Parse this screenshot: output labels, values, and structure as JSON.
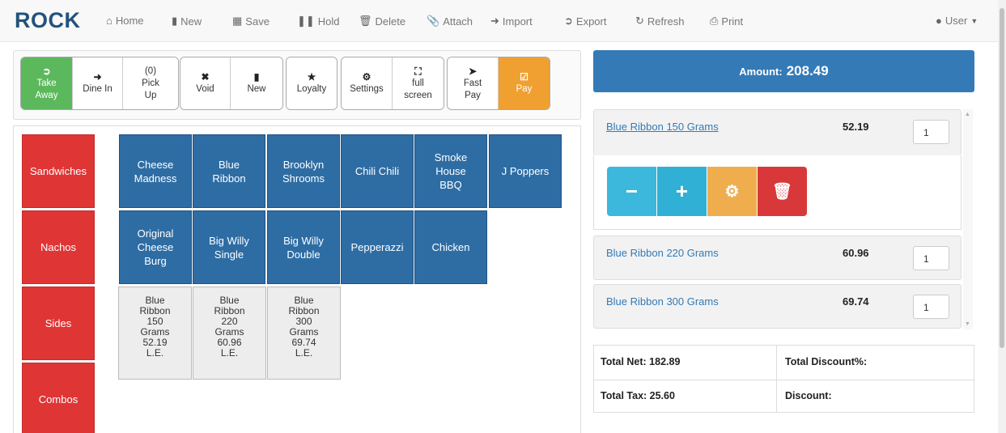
{
  "brand": "ROCK",
  "nav": {
    "home": "Home",
    "new": "New",
    "save": "Save",
    "hold": "Hold",
    "delete": "Delete",
    "attach": "Attach",
    "import": "Import",
    "export": "Export",
    "refresh": "Refresh",
    "print": "Print",
    "user": "User"
  },
  "actions": {
    "take_away_1": "Take",
    "take_away_2": "Away",
    "dine_in": "Dine In",
    "pickup_count": "(0)",
    "pickup_1": "Pick",
    "pickup_2": "Up",
    "void": "Void",
    "new": "New",
    "loyalty": "Loyalty",
    "settings": "Settings",
    "fullscreen_1": "full",
    "fullscreen_2": "screen",
    "fastpay_1": "Fast",
    "fastpay_2": "Pay",
    "pay": "Pay"
  },
  "categories": [
    "Sandwiches",
    "Nachos",
    "Sides",
    "Combos"
  ],
  "products": {
    "row1": [
      [
        "Cheese",
        "Madness"
      ],
      [
        "Blue",
        "Ribbon"
      ],
      [
        "Brooklyn",
        "Shrooms"
      ],
      [
        "Chili Chili"
      ],
      [
        "Smoke",
        "House",
        "BBQ"
      ],
      [
        "J Poppers"
      ]
    ],
    "row2": [
      [
        "Original",
        "Cheese",
        "Burg"
      ],
      [
        "Big Willy",
        "Single"
      ],
      [
        "Big Willy",
        "Double"
      ],
      [
        "Pepperazzi"
      ],
      [
        "Chicken"
      ]
    ]
  },
  "variants": [
    {
      "l1": "Blue",
      "l2": "Ribbon",
      "l3": "150",
      "l4": "Grams",
      "price": "52.19",
      "cur": "L.E."
    },
    {
      "l1": "Blue",
      "l2": "Ribbon",
      "l3": "220",
      "l4": "Grams",
      "price": "60.96",
      "cur": "L.E."
    },
    {
      "l1": "Blue",
      "l2": "Ribbon",
      "l3": "300",
      "l4": "Grams",
      "price": "69.74",
      "cur": "L.E."
    }
  ],
  "amount": {
    "label": "Amount:",
    "value": "208.49"
  },
  "order_lines": [
    {
      "name": "Blue Ribbon 150 Grams",
      "price": "52.19",
      "qty": "1"
    },
    {
      "name": "Blue Ribbon 220 Grams",
      "price": "60.96",
      "qty": "1"
    },
    {
      "name": "Blue Ribbon 300 Grams",
      "price": "69.74",
      "qty": "1"
    }
  ],
  "totals": {
    "net": "Total Net: 182.89",
    "discount_pct": "Total Discount%:",
    "tax": "Total Tax: 25.60",
    "discount": "Discount:"
  },
  "colors": {
    "brand": "#23527c",
    "primary": "#337ab7",
    "product_tile": "#2e6da4",
    "category_tile": "#e03535",
    "take_away": "#5cb85c",
    "pay": "#f0a030",
    "minus": "#3bb8dc",
    "plus": "#31b0d5",
    "gear": "#f0ad4e",
    "trash": "#d9383a"
  }
}
